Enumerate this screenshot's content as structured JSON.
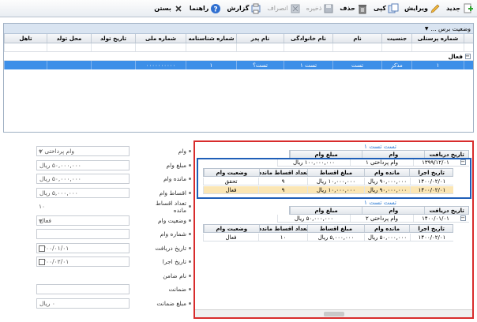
{
  "toolbar": {
    "new_label": "جدید",
    "edit_label": "ویرایش",
    "copy_label": "کپی",
    "delete_label": "حذف",
    "save_label": "ذخیره",
    "cancel_label": "انصراف",
    "report_label": "گزارش",
    "help_label": "راهنما",
    "close_label": "بستن"
  },
  "top_grid": {
    "dropdown_label": "وضعیت برس ...",
    "columns": [
      "شماره پرسنلی",
      "جنسیت",
      "نام",
      "نام خانوادگی",
      "نام پدر",
      "شماره شناسنامه",
      "شماره ملی",
      "تاریخ تولد",
      "محل تولد",
      "تاهل"
    ],
    "group_label": "فعال",
    "row": [
      "۱",
      "مذکر",
      "تست",
      "تست ۱",
      "تست؟",
      "۱",
      "۰۰۰۰۰۰۰۰۰۰",
      "",
      "",
      ""
    ]
  },
  "form": {
    "rows": [
      {
        "label": "وام",
        "value": "وام پرداختی ۲",
        "kind": "dropdown"
      },
      {
        "label": "مبلغ وام",
        "value": "۵۰,۰۰۰,۰۰۰ ریال",
        "kind": "text"
      },
      {
        "label": "مانده وام",
        "value": "۵۰,۰۰۰,۰۰۰ ریال",
        "kind": "text"
      },
      {
        "label": "اقساط وام",
        "value": "۵,۰۰۰,۰۰۰ ریال",
        "kind": "text"
      },
      {
        "label": "تعداد اقساط مانده",
        "value": "۱۰",
        "kind": "plain"
      },
      {
        "label": "وضعیت وام",
        "value": "فعال",
        "kind": "dropdown"
      },
      {
        "label": "شماره وام",
        "value": "",
        "kind": "text"
      },
      {
        "label": "تاریخ دریافت",
        "value": "۱۴۰۰/۰۱/۰۱",
        "kind": "date"
      },
      {
        "label": "تاریخ اجرا",
        "value": "۱۴۰۰/۰۲/۰۱",
        "kind": "date"
      },
      {
        "label": "نام ضامن",
        "value": "",
        "kind": "plain"
      },
      {
        "label": "ضمانت",
        "value": "",
        "kind": "text"
      },
      {
        "label": "مبلغ ضمانت",
        "value": "۰ ریال",
        "kind": "text"
      }
    ]
  },
  "detail": {
    "block1": {
      "caption": "تست تست ۱",
      "loan_headers": [
        "تاریخ دریافت",
        "وام",
        "مبلغ وام"
      ],
      "loan_row": [
        "۱۳۹۹/۱۲/۰۱",
        "وام پرداختی ۱",
        "۱۰۰,۰۰۰,۰۰۰ ریال"
      ],
      "inst_headers": [
        "تاریخ اجرا",
        "مانده وام",
        "مبلغ اقساط",
        "تعداد اقساط مانده",
        "وضعیت وام"
      ],
      "inst_rows": [
        [
          "۱۴۰۰/۰۲/۰۱",
          "۹۰,۰۰۰,۰۰۰ ریال",
          "۱۰,۰۰۰,۰۰۰ ریال",
          "۹",
          "تحقق"
        ],
        [
          "۱۴۰۰/۰۲/۰۱",
          "۹۰,۰۰۰,۰۰۰ ریال",
          "۱۰,۰۰۰,۰۰۰ ریال",
          "۹",
          "فعال"
        ]
      ]
    },
    "block2": {
      "caption": "تست تست ۱",
      "loan_headers": [
        "تاریخ دریافت",
        "وام",
        "مبلغ وام"
      ],
      "loan_row": [
        "۱۴۰۰/۰۱/۰۱",
        "وام پرداختی ۲",
        "۵۰,۰۰۰,۰۰۰ ریال"
      ],
      "inst_headers": [
        "تاریخ اجرا",
        "مانده وام",
        "مبلغ اقساط",
        "تعداد اقساط مانده",
        "وضعیت وام"
      ],
      "inst_rows": [
        [
          "۱۴۰۰/۰۲/۰۱",
          "۵۰,۰۰۰,۰۰۰ ریال",
          "۵,۰۰۰,۰۰۰ ریال",
          "۱۰",
          "فعال"
        ]
      ]
    }
  }
}
